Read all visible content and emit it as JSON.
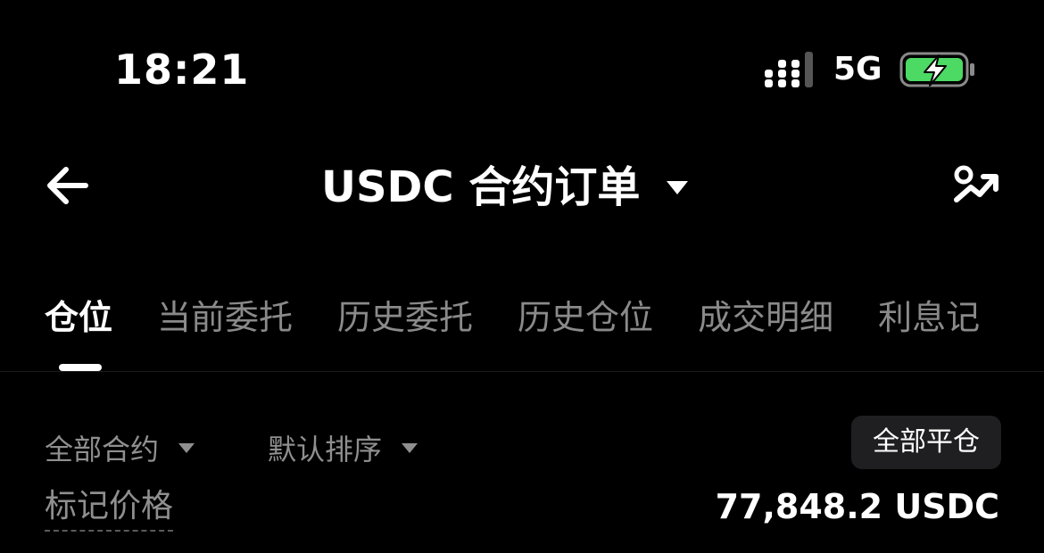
{
  "status_bar": {
    "time": "18:21",
    "network": "5G",
    "signal_icon": "signal-bars-icon",
    "battery_icon": "battery-charging-icon",
    "battery_color": "#4cd964"
  },
  "header": {
    "back_icon": "arrow-left-icon",
    "title": "USDC 合约订单",
    "title_dropdown_icon": "caret-down-icon",
    "right_icon": "share-trend-icon"
  },
  "tabs": [
    {
      "label": "仓位",
      "active": true
    },
    {
      "label": "当前委托",
      "active": false
    },
    {
      "label": "历史委托",
      "active": false
    },
    {
      "label": "历史仓位",
      "active": false
    },
    {
      "label": "成交明细",
      "active": false
    },
    {
      "label": "利息记",
      "active": false
    }
  ],
  "filters": {
    "contract_filter": "全部合约",
    "sort_filter": "默认排序",
    "close_all_button": "全部平仓"
  },
  "mark_price": {
    "label": "标记价格",
    "value": "77,848.2 USDC"
  }
}
